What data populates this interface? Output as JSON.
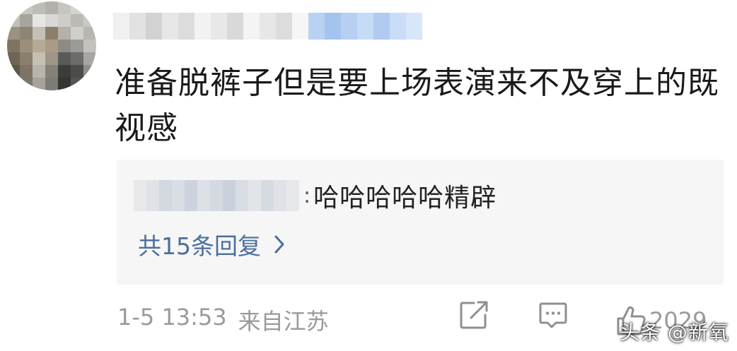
{
  "comment": {
    "content": "准备脱裤子但是要上场表演来不及穿上的既视感",
    "timestamp": "1-5 13:53",
    "location": "来自江苏",
    "like_count": "2029"
  },
  "reply": {
    "separator": ":",
    "text": "哈哈哈哈哈精辟",
    "more_label": "共15条回复"
  },
  "watermark": "头条 @新氧",
  "colors": {
    "link": "#4a6e9e",
    "reply_bg": "#f6f6f6",
    "meta_text": "#9a9a9a",
    "content_text": "#1a1a1a"
  },
  "icons": {
    "share": "share-icon",
    "comment": "comment-icon",
    "like": "thumbs-up-icon",
    "more": "chevron-right-icon"
  }
}
